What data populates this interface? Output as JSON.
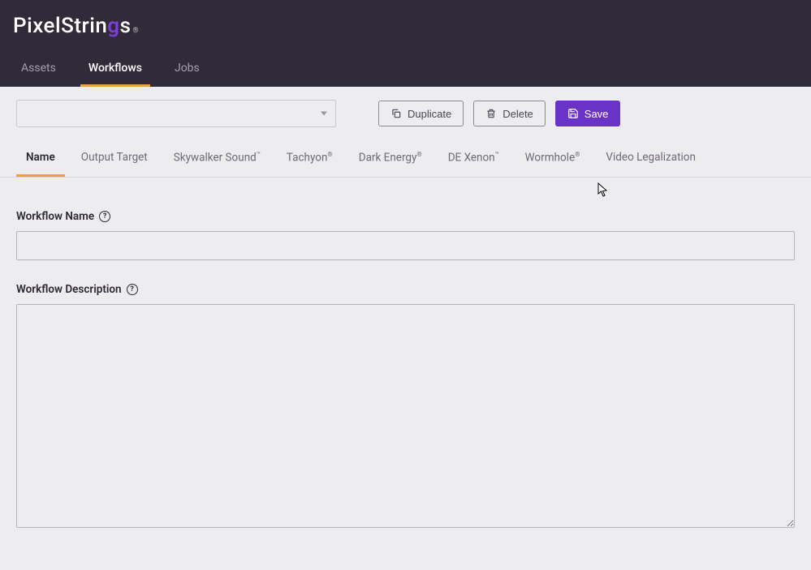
{
  "logo": {
    "text_a": "PixelStrin",
    "text_b": "s",
    "tm": "®"
  },
  "nav": {
    "items": [
      {
        "label": "Assets",
        "active": false
      },
      {
        "label": "Workflows",
        "active": true
      },
      {
        "label": "Jobs",
        "active": false
      }
    ]
  },
  "toolbar": {
    "select_value": "",
    "duplicate_label": "Duplicate",
    "delete_label": "Delete",
    "save_label": "Save"
  },
  "subtabs": {
    "items": [
      {
        "label": "Name",
        "sup": "",
        "active": true
      },
      {
        "label": "Output Target",
        "sup": "",
        "active": false
      },
      {
        "label": "Skywalker Sound",
        "sup": "™",
        "active": false
      },
      {
        "label": "Tachyon",
        "sup": "®",
        "active": false
      },
      {
        "label": "Dark Energy",
        "sup": "®",
        "active": false
      },
      {
        "label": "DE Xenon",
        "sup": "™",
        "active": false
      },
      {
        "label": "Wormhole",
        "sup": "®",
        "active": false
      },
      {
        "label": "Video Legalization",
        "sup": "",
        "active": false
      }
    ]
  },
  "form": {
    "name_label": "Workflow Name",
    "name_value": "",
    "desc_label": "Workflow Description",
    "desc_value": ""
  }
}
